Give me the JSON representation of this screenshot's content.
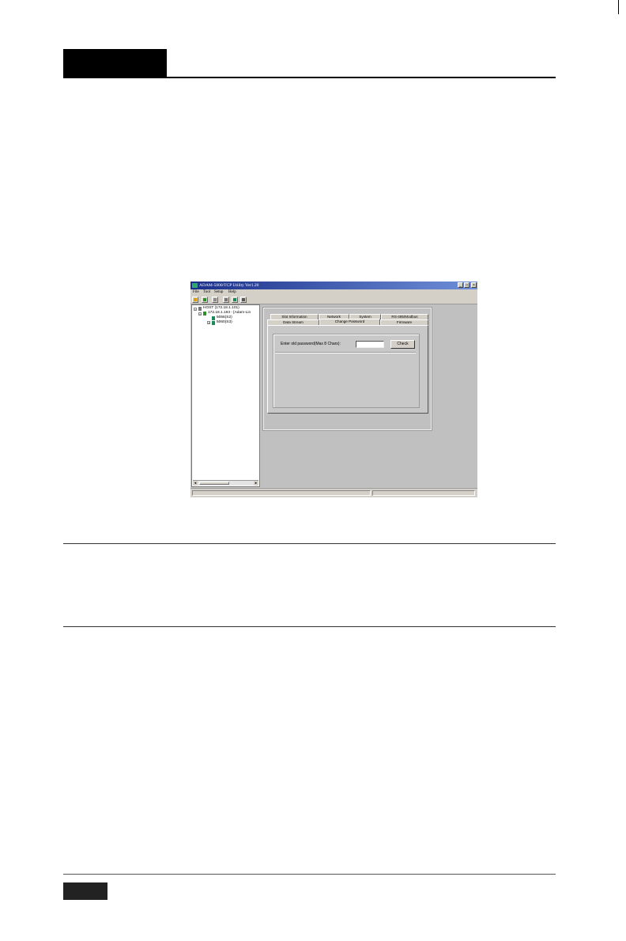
{
  "window": {
    "title": "ADAM-5000/TCP Utility Ver1.20",
    "controls": {
      "minimize": "_",
      "maximize": "□",
      "close": "×"
    }
  },
  "menu": [
    "File",
    "Tool",
    "Setup",
    "Help"
  ],
  "toolbar": {
    "icons": [
      "exit-icon",
      "search-icon",
      "find-icon",
      "connect-icon",
      "network-icon",
      "list-icon"
    ]
  },
  "tree": {
    "root": "HOST (172.18.1.101)",
    "device": "172.18.1.193 - [Adam-Lin",
    "modules": [
      "5056(S2)",
      "5060(S3)"
    ],
    "expand_minus": "−",
    "expand_plus": "+",
    "scroll_left": "◄",
    "scroll_right": "►"
  },
  "tabs": {
    "row1": [
      "Slot Information",
      "Network",
      "System",
      "RS-485/Modbus"
    ],
    "row2": [
      "Data Stream",
      "Change Password",
      "Firmware"
    ],
    "active": "Change Password"
  },
  "password_form": {
    "label": "Enter old password(Max 8 Chars):",
    "value": "",
    "button": "Check"
  },
  "colors": {
    "title_start": "#1a2f8a",
    "title_end": "#6f8fd8",
    "pane_bg": "#c0c0c0",
    "header_block": "#000000"
  }
}
